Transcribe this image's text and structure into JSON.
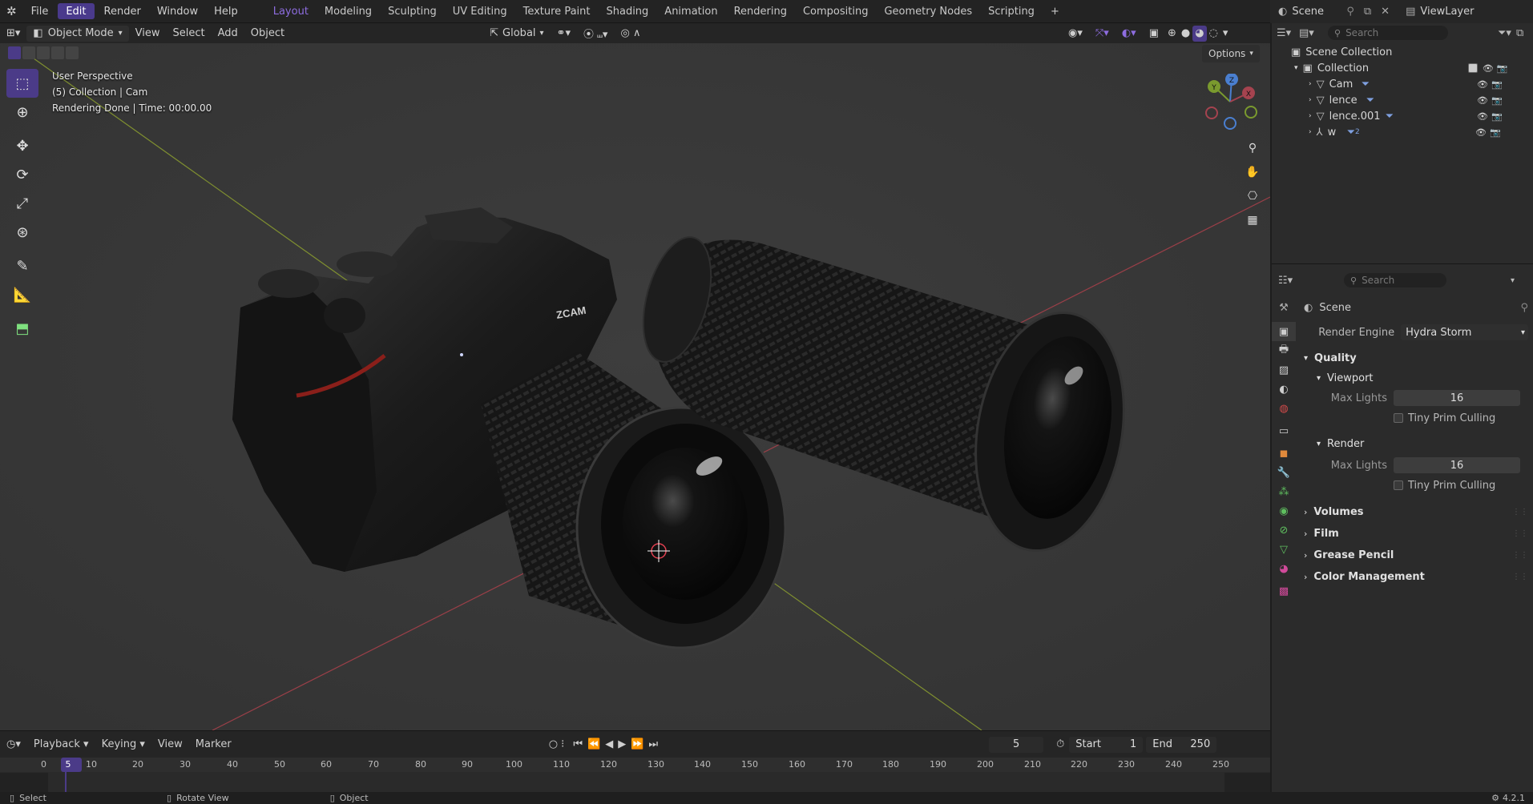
{
  "topbar": {
    "menus": [
      "File",
      "Edit",
      "Render",
      "Window",
      "Help"
    ],
    "workspaces": [
      "Layout",
      "Modeling",
      "Sculpting",
      "UV Editing",
      "Texture Paint",
      "Shading",
      "Animation",
      "Rendering",
      "Compositing",
      "Geometry Nodes",
      "Scripting"
    ],
    "active_workspace": "Layout",
    "scene": "Scene",
    "viewlayer": "ViewLayer"
  },
  "viewport_header": {
    "mode": "Object Mode",
    "menus": [
      "View",
      "Select",
      "Add",
      "Object"
    ],
    "orientation": "Global",
    "options": "Options"
  },
  "viewport": {
    "perspective": "User Perspective",
    "collection_line": "(5) Collection | Cam",
    "render_status": "Rendering Done | Time: 00:00.00",
    "camera_brand": "ZCAM",
    "gizmo_axes": [
      "Y",
      "Z",
      "X"
    ]
  },
  "outliner": {
    "search_placeholder": "Search",
    "root": "Scene Collection",
    "collection": "Collection",
    "objects": [
      {
        "name": "Cam"
      },
      {
        "name": "lence"
      },
      {
        "name": "lence.001"
      },
      {
        "name": "w"
      }
    ],
    "w_badge": "2"
  },
  "properties": {
    "search_placeholder": "Search",
    "context": "Scene",
    "render_engine_label": "Render Engine",
    "render_engine": "Hydra Storm",
    "quality": "Quality",
    "viewport_sub": "Viewport",
    "render_sub": "Render",
    "max_lights_label": "Max Lights",
    "viewport_max_lights": "16",
    "render_max_lights": "16",
    "tiny_prim": "Tiny Prim Culling",
    "panels": [
      "Volumes",
      "Film",
      "Grease Pencil",
      "Color Management"
    ]
  },
  "timeline": {
    "menus": [
      "Playback",
      "Keying",
      "View",
      "Marker"
    ],
    "current_frame": "5",
    "start_label": "Start",
    "start": "1",
    "end_label": "End",
    "end": "250",
    "ticks": [
      "0",
      "5",
      "10",
      "20",
      "30",
      "40",
      "50",
      "60",
      "70",
      "80",
      "90",
      "100",
      "110",
      "120",
      "130",
      "140",
      "150",
      "160",
      "170",
      "180",
      "190",
      "200",
      "210",
      "220",
      "230",
      "240",
      "250"
    ]
  },
  "status": {
    "select": "Select",
    "rotate": "Rotate View",
    "object": "Object",
    "version": "4.2.1"
  },
  "colors": {
    "accent": "#4b3b88",
    "x_axis": "#a5434f",
    "y_axis": "#7a9a2e",
    "z_axis": "#4a7fd0"
  }
}
